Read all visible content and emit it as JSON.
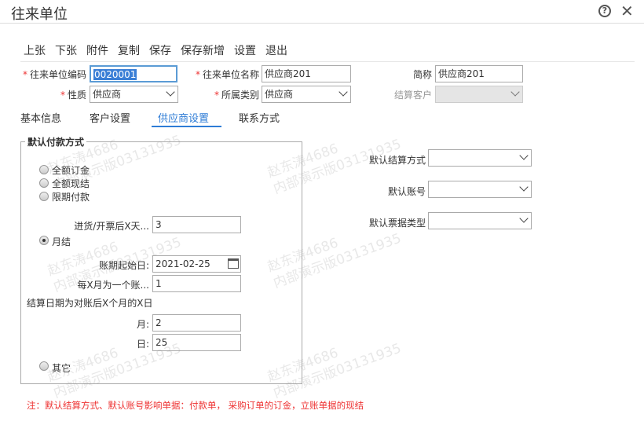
{
  "window": {
    "title": "往来单位",
    "help_icon": "help-circle-icon",
    "close_icon": "close-icon"
  },
  "toolbar": [
    "上张",
    "下张",
    "附件",
    "复制",
    "保存",
    "保存新增",
    "设置",
    "退出"
  ],
  "form": {
    "code_label": "往来单位编码",
    "code_value": "0020001",
    "name_label": "往来单位名称",
    "name_value": "供应商201",
    "short_label": "简称",
    "short_value": "供应商201",
    "nature_label": "性质",
    "nature_value": "供应商",
    "category_label": "所属类别",
    "category_value": "供应商",
    "settle_customer_label": "结算客户",
    "settle_customer_value": ""
  },
  "tabs": {
    "basic": "基本信息",
    "customer": "客户设置",
    "supplier": "供应商设置",
    "contact": "联系方式"
  },
  "payment": {
    "legend": "默认付款方式",
    "opt_full_order": "全额订金",
    "opt_full_cash": "全额现结",
    "opt_limited": "限期付款",
    "days_label": "进货/开票后X天...",
    "days_value": "3",
    "opt_monthly": "月结",
    "period_start_label": "账期起始日:",
    "period_start_value": "2021-02-25",
    "per_months_label": "每X月为一个账...",
    "per_months_value": "1",
    "settle_rule_text": "结算日期为对账后X个月的X日",
    "month_label": "月:",
    "month_value": "2",
    "day_label": "日:",
    "day_value": "25",
    "opt_other": "其它",
    "selected": "月结"
  },
  "right": {
    "settle_method_label": "默认结算方式",
    "settle_method_value": "",
    "account_label": "默认账号",
    "account_value": "",
    "bill_type_label": "默认票据类型",
    "bill_type_value": ""
  },
  "note": "注：默认结算方式、默认账号影响单据：付款单， 采购订单的订金，立账单据的现结",
  "watermark": {
    "line1": "赵东涛4686",
    "line2": "内部演示版03131935"
  },
  "colors": {
    "accent": "#2e7cd6",
    "required": "#e33333",
    "highlight": "#3b7fd6"
  }
}
